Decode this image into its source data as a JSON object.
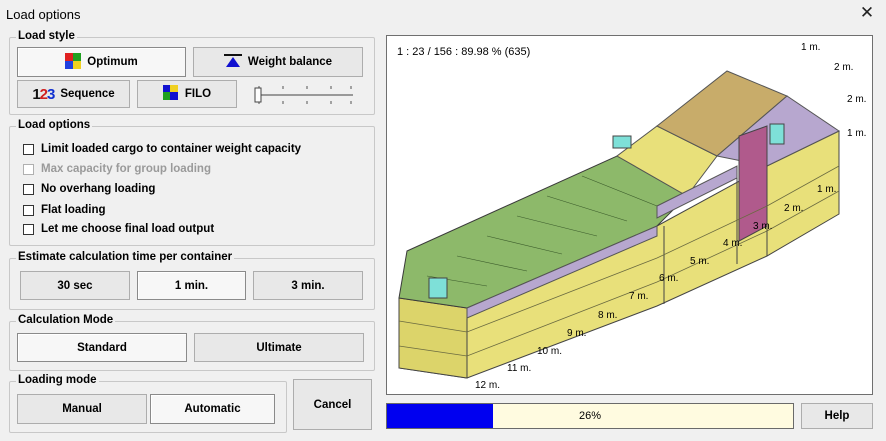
{
  "window": {
    "title": "Load options",
    "close_glyph": "✕"
  },
  "load_style": {
    "legend": "Load style",
    "optimum": "Optimum",
    "weight_balance": "Weight balance",
    "sequence": "Sequence",
    "sequence_icon_digits": [
      "1",
      "2",
      "3"
    ],
    "filo": "FILO",
    "slider_value": 0
  },
  "load_options": {
    "legend": "Load options",
    "items": [
      {
        "label": "Limit loaded cargo to container weight capacity",
        "checked": false,
        "enabled": true
      },
      {
        "label": "Max capacity for group loading",
        "checked": false,
        "enabled": false
      },
      {
        "label": "No overhang loading",
        "checked": false,
        "enabled": true
      },
      {
        "label": "Flat loading",
        "checked": false,
        "enabled": true
      },
      {
        "label": "Let me choose final load output",
        "checked": false,
        "enabled": true
      }
    ]
  },
  "estimate": {
    "legend": "Estimate calculation time per container",
    "options": [
      "30 sec",
      "1 min.",
      "3 min."
    ],
    "selected": "1 min."
  },
  "calc_mode": {
    "legend": "Calculation Mode",
    "options": [
      "Standard",
      "Ultimate"
    ],
    "selected": "Standard"
  },
  "loading_mode": {
    "legend": "Loading mode",
    "options": [
      "Manual",
      "Automatic"
    ],
    "selected": "Automatic"
  },
  "cancel": "Cancel",
  "help": "Help",
  "viewer": {
    "info": "1 : 23 / 156 : 89.98 % (635)",
    "meters": [
      "1 m.",
      "2 m.",
      "2 m.",
      "1 m.",
      "1 m.",
      "2 m.",
      "3 m.",
      "4 m.",
      "5 m.",
      "6 m.",
      "7 m.",
      "8 m.",
      "9 m.",
      "10 m.",
      "11 m.",
      "12 m."
    ]
  },
  "progress": {
    "value": 0.26,
    "label": "26%"
  },
  "colors": {
    "progress_fill": "#0000f0",
    "progress_bg": "#fffbe0",
    "cargo_yellow": "#e8e07a",
    "cargo_green": "#8db96a",
    "cargo_lilac": "#b7a7cf",
    "cargo_magenta": "#b05a8c",
    "cargo_cyan": "#7ee0d8",
    "cargo_tan": "#c8ac6a"
  }
}
